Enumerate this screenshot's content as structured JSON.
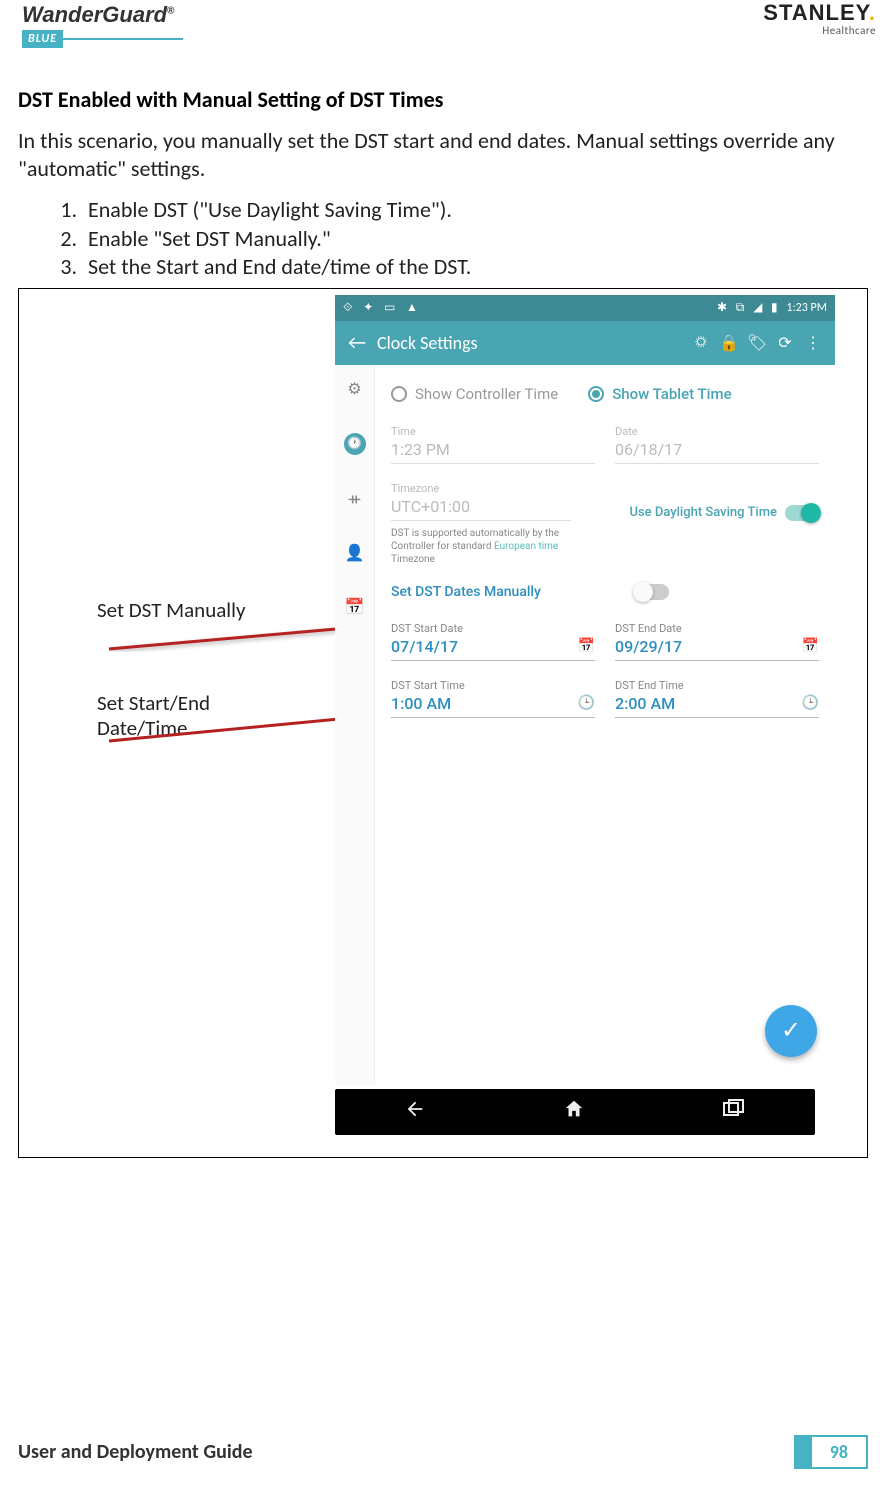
{
  "header": {
    "product_logo_text": "WanderGuard",
    "product_logo_sub": "BLUE",
    "reg_mark": "®",
    "company_logo_text": "STANLEY",
    "company_logo_sub": "Healthcare"
  },
  "section": {
    "title": "DST Enabled with Manual Setting of DST Times",
    "intro": "In this scenario, you manually set the DST start and end dates. Manual settings override any \"automatic\" settings.",
    "steps": [
      "Enable DST (\"Use Daylight Saving Time\").",
      "Enable \"Set DST Manually.\"",
      "Set the Start and End date/time of the DST."
    ]
  },
  "annotations": {
    "a1": "Set DST Manually",
    "a2_line1": "Set Start/End",
    "a2_line2": "Date/Time"
  },
  "phone": {
    "status": {
      "left_icons": [
        "bluetooth-icon",
        "sync-icon",
        "image-icon",
        "warning-icon"
      ],
      "right_icons": [
        "bluetooth-icon",
        "wifi-icon",
        "signal-icon",
        "battery-icon"
      ],
      "time": "1:23 PM"
    },
    "appbar": {
      "title": "Clock Settings",
      "actions": [
        "brightness-icon",
        "lock-icon",
        "tag-icon",
        "refresh-icon",
        "more-icon"
      ]
    },
    "siderail": [
      "gear-icon",
      "clock-icon",
      "tree-icon",
      "person-icon",
      "calendar-icon"
    ],
    "radios": {
      "controller": "Show Controller Time",
      "tablet": "Show Tablet Time"
    },
    "fields": {
      "time_label": "Time",
      "time_value": "1:23 PM",
      "date_label": "Date",
      "date_value": "06/18/17",
      "tz_label": "Timezone",
      "tz_value": "UTC+01:00"
    },
    "dst_toggle_label": "Use Daylight Saving Time",
    "dst_note_pre": "DST is supported automatically by the Controller for standard ",
    "dst_note_link": "European time",
    "dst_note_post": " Timezone",
    "manual_toggle_label": "Set DST Dates Manually",
    "dst_start_date_label": "DST Start Date",
    "dst_start_date_value": "07/14/17",
    "dst_end_date_label": "DST End Date",
    "dst_end_date_value": "09/29/17",
    "dst_start_time_label": "DST Start Time",
    "dst_start_time_value": "1:00 AM",
    "dst_end_time_label": "DST End Time",
    "dst_end_time_value": "2:00 AM"
  },
  "footer": {
    "guide": "User and Deployment Guide",
    "page": "98"
  }
}
